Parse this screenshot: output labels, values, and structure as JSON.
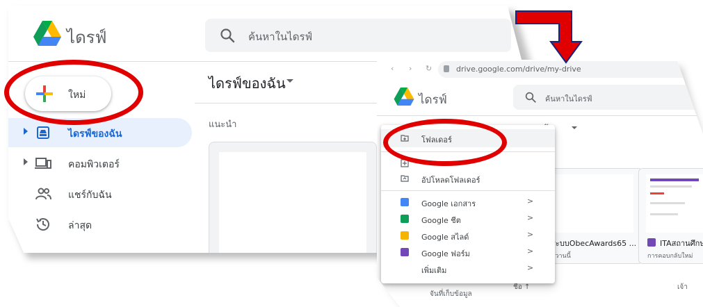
{
  "left_window": {
    "app_name": "ไดรฟ์",
    "search_placeholder": "ค้นหาในไดรฟ์",
    "new_button_label": "ใหม่",
    "nav": [
      {
        "label": "ไดรฟ์ของฉัน",
        "icon": "my-drive-icon",
        "active": true
      },
      {
        "label": "คอมพิวเตอร์",
        "icon": "computer-icon",
        "active": false
      },
      {
        "label": "แชร์กับฉัน",
        "icon": "shared-icon",
        "active": false
      },
      {
        "label": "ล่าสุด",
        "icon": "recent-icon",
        "active": false
      }
    ],
    "breadcrumb": "ไดรฟ์ของฉัน",
    "section_label": "แนะนำ"
  },
  "right_window": {
    "url": "drive.google.com/drive/my-drive",
    "app_name": "ไดรฟ์",
    "search_placeholder": "ค้นหาในไดรฟ์",
    "breadcrumb": "งฉัน",
    "menu": {
      "items": [
        {
          "label": "โฟลเดอร์",
          "icon": "new-folder-icon"
        },
        {
          "label": "อัปโหลดโฟลเดอร์",
          "icon": "folder-upload-icon"
        },
        {
          "label": "Google เอกสาร",
          "icon": "google-docs-icon",
          "color": "#4285f4"
        },
        {
          "label": "Google ชีต",
          "icon": "google-sheets-icon",
          "color": "#0f9d58"
        },
        {
          "label": "Google สไลด์",
          "icon": "google-slides-icon",
          "color": "#f4b400"
        },
        {
          "label": "Google ฟอร์ม",
          "icon": "google-forms-icon",
          "color": "#7248b9"
        },
        {
          "label": "เพิ่มเติม",
          "icon": "more-icon"
        }
      ],
      "chevron": ">"
    },
    "files": [
      {
        "name": "ระบบObecAwards65 ...",
        "meta": "อวานนี้"
      },
      {
        "name": "ITAสถานศึกษ",
        "meta": "การคอบกลับใหม่"
      }
    ],
    "footer_left": "จันที่เก็บข้อมูล",
    "footer_mid": "ชื่อ ↑",
    "footer_right": "เจ้า"
  },
  "colors": {
    "highlight_ring": "#e00000",
    "arrow": "#e00000",
    "arrow_outline": "#1a237e",
    "active_nav_bg": "#e8f0fe",
    "active_nav_text": "#1967d2"
  }
}
